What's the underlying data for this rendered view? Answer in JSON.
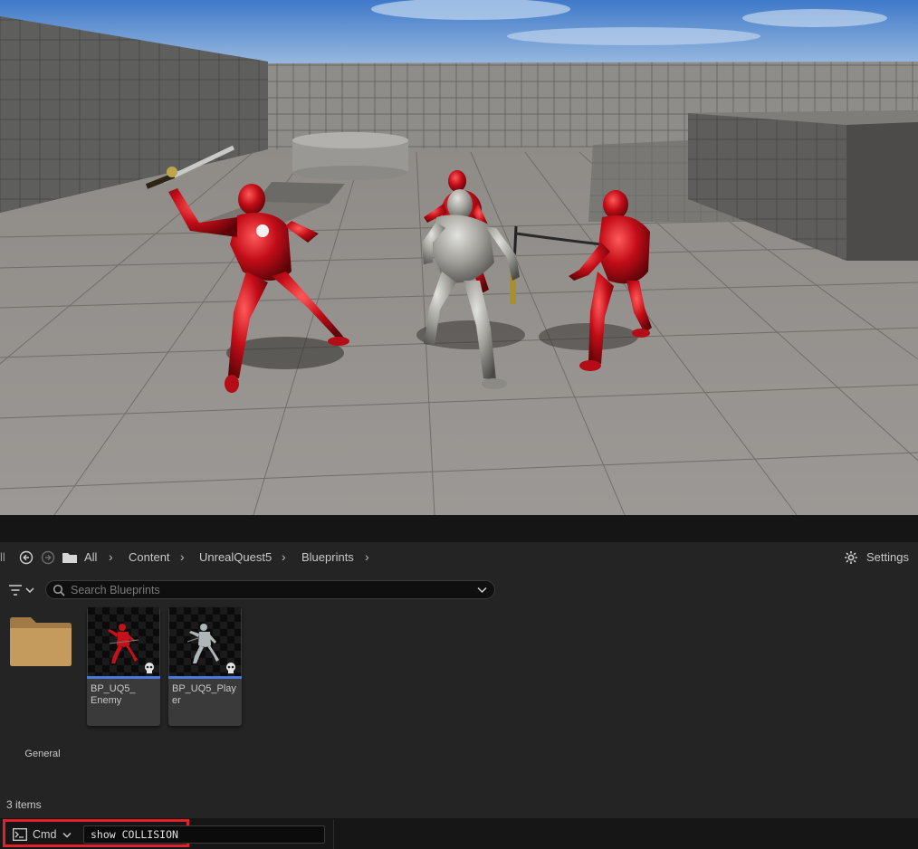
{
  "breadcrumb": {
    "cut_label": "ll",
    "root": "All",
    "segments": [
      "Content",
      "UnrealQuest5",
      "Blueprints"
    ]
  },
  "settings": {
    "label": "Settings"
  },
  "search": {
    "placeholder": "Search Blueprints",
    "value": ""
  },
  "assets": [
    {
      "name": "General",
      "type": "folder"
    },
    {
      "name": "BP_UQ5_\nEnemy",
      "type": "blueprint",
      "figure_color": "#c4111a"
    },
    {
      "name": "BP_UQ5_Player",
      "type": "blueprint",
      "figure_color": "#aeb6b8"
    }
  ],
  "status": {
    "item_count": "3 items"
  },
  "command": {
    "label": "Cmd",
    "value": "show COLLISION"
  },
  "colors": {
    "accent_blue": "#4a7ad8",
    "highlight_red": "#e0202b",
    "enemy_red": "#c4111a",
    "player_silver": "#a7a7a3",
    "folder_tan": "#c49a5d"
  },
  "icons": [
    "back-arrow-icon",
    "forward-arrow-icon",
    "folder-icon",
    "chevron-right-icon",
    "gear-icon",
    "filter-icon",
    "chevron-down-icon",
    "search-icon",
    "console-icon",
    "skull-icon"
  ]
}
